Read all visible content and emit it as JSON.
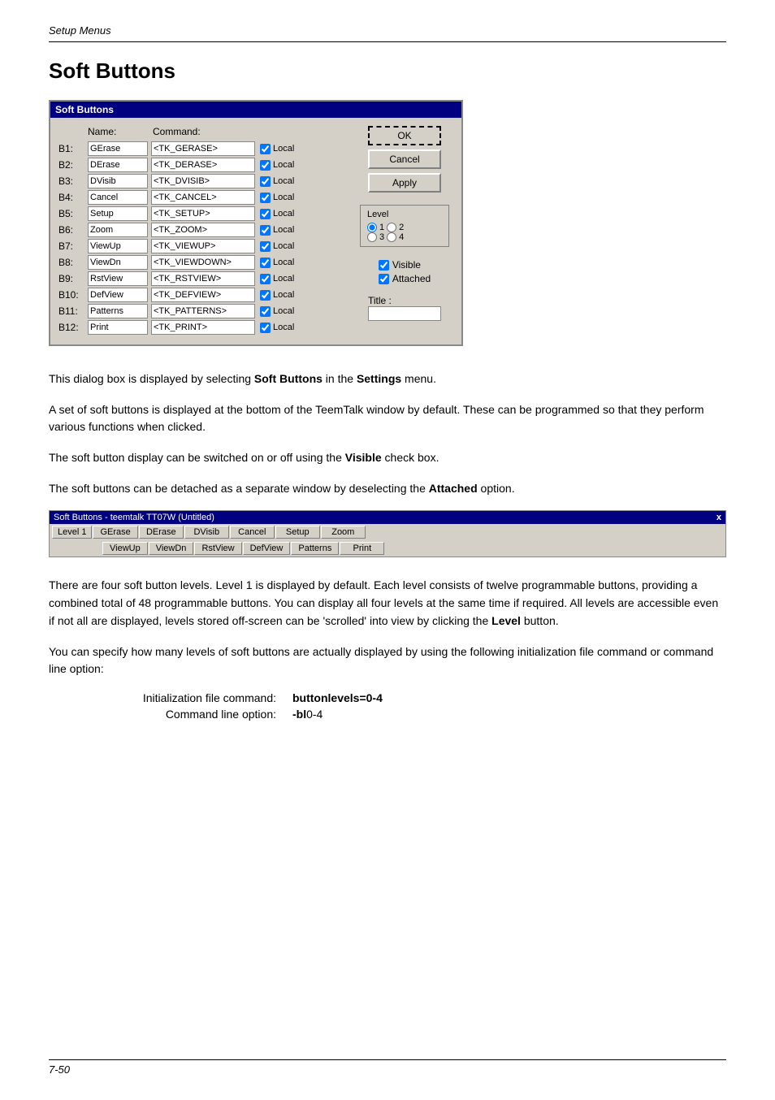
{
  "header": {
    "title": "Setup Menus"
  },
  "page_title": "Soft Buttons",
  "dialog": {
    "titlebar": "Soft Buttons",
    "columns": {
      "name": "Name:",
      "command": "Command:"
    },
    "rows": [
      {
        "label": "B1:",
        "name": "GErase",
        "command": "<TK_GERASE>",
        "checked": true,
        "local": "Local"
      },
      {
        "label": "B2:",
        "name": "DErase",
        "command": "<TK_DERASE>",
        "checked": true,
        "local": "Local"
      },
      {
        "label": "B3:",
        "name": "DVisib",
        "command": "<TK_DVISIB>",
        "checked": true,
        "local": "Local"
      },
      {
        "label": "B4:",
        "name": "Cancel",
        "command": "<TK_CANCEL>",
        "checked": true,
        "local": "Local"
      },
      {
        "label": "B5:",
        "name": "Setup",
        "command": "<TK_SETUP>",
        "checked": true,
        "local": "Local"
      },
      {
        "label": "B6:",
        "name": "Zoom",
        "command": "<TK_ZOOM>",
        "checked": true,
        "local": "Local"
      },
      {
        "label": "B7:",
        "name": "ViewUp",
        "command": "<TK_VIEWUP>",
        "checked": true,
        "local": "Local"
      },
      {
        "label": "B8:",
        "name": "ViewDn",
        "command": "<TK_VIEWDOWN>",
        "checked": true,
        "local": "Local"
      },
      {
        "label": "B9:",
        "name": "RstView",
        "command": "<TK_RSTVIEW>",
        "checked": true,
        "local": "Local"
      },
      {
        "label": "B10:",
        "name": "DefView",
        "command": "<TK_DEFVIEW>",
        "checked": true,
        "local": "Local"
      },
      {
        "label": "B11:",
        "name": "Patterns",
        "command": "<TK_PATTERNS>",
        "checked": true,
        "local": "Local"
      },
      {
        "label": "B12:",
        "name": "Print",
        "command": "<TK_PRINT>",
        "checked": true,
        "local": "Local"
      }
    ],
    "buttons": {
      "ok": "OK",
      "cancel": "Cancel",
      "apply": "Apply"
    },
    "level": {
      "title": "Level",
      "options": [
        {
          "id": "r1",
          "label": "1",
          "value": "1",
          "checked": true
        },
        {
          "id": "r2",
          "label": "2",
          "value": "2",
          "checked": false
        },
        {
          "id": "r3",
          "label": "3",
          "value": "3",
          "checked": false
        },
        {
          "id": "r4",
          "label": "4",
          "value": "4",
          "checked": false
        }
      ]
    },
    "visible": {
      "label": "Visible",
      "checked": true
    },
    "attached": {
      "label": "Attached",
      "checked": true
    },
    "title_field": {
      "label": "Title :",
      "value": ""
    }
  },
  "body_paragraphs": [
    "This dialog box is displayed by selecting <b>Soft Buttons</b> in the <b>Settings</b> menu.",
    "A set of soft buttons is displayed at the bottom of the TeemTalk window by default. These can be programmed so that they perform various functions when clicked.",
    "The soft button display can be switched on or off using the <b>Visible</b> check box.",
    "The soft buttons can be detached as a separate window by deselecting the <b>Attached</b> option."
  ],
  "taskbar": {
    "title": "Soft Buttons - teemtalk TT07W (Untitled)",
    "close": "x",
    "level_btn": "Level 1",
    "buttons_row1": [
      "GErase",
      "DErase",
      "DVisib",
      "Cancel",
      "Setup",
      "Zoom"
    ],
    "buttons_row2": [
      "ViewUp",
      "ViewDn",
      "RstView",
      "DefView",
      "Patterns",
      "Print"
    ]
  },
  "body_paragraphs2": [
    "There are four soft button levels. Level 1 is displayed by default. Each level consists of twelve programmable buttons, providing a combined total of 48 programmable buttons. You can display all four levels at the same time if required. All levels are accessible even if not all are displayed, levels stored off-screen can be 'scrolled' into view by clicking the <b>Level</b> button.",
    "You can specify how many levels of soft buttons are actually displayed by using the following initialization file command or command line option:"
  ],
  "init_table": {
    "rows": [
      {
        "label": "Initialization file command:",
        "value": "buttonlevels=0-4"
      },
      {
        "label": "Command line option:",
        "value": "-bl0-4"
      }
    ]
  },
  "footer": {
    "page_number": "7-50"
  }
}
